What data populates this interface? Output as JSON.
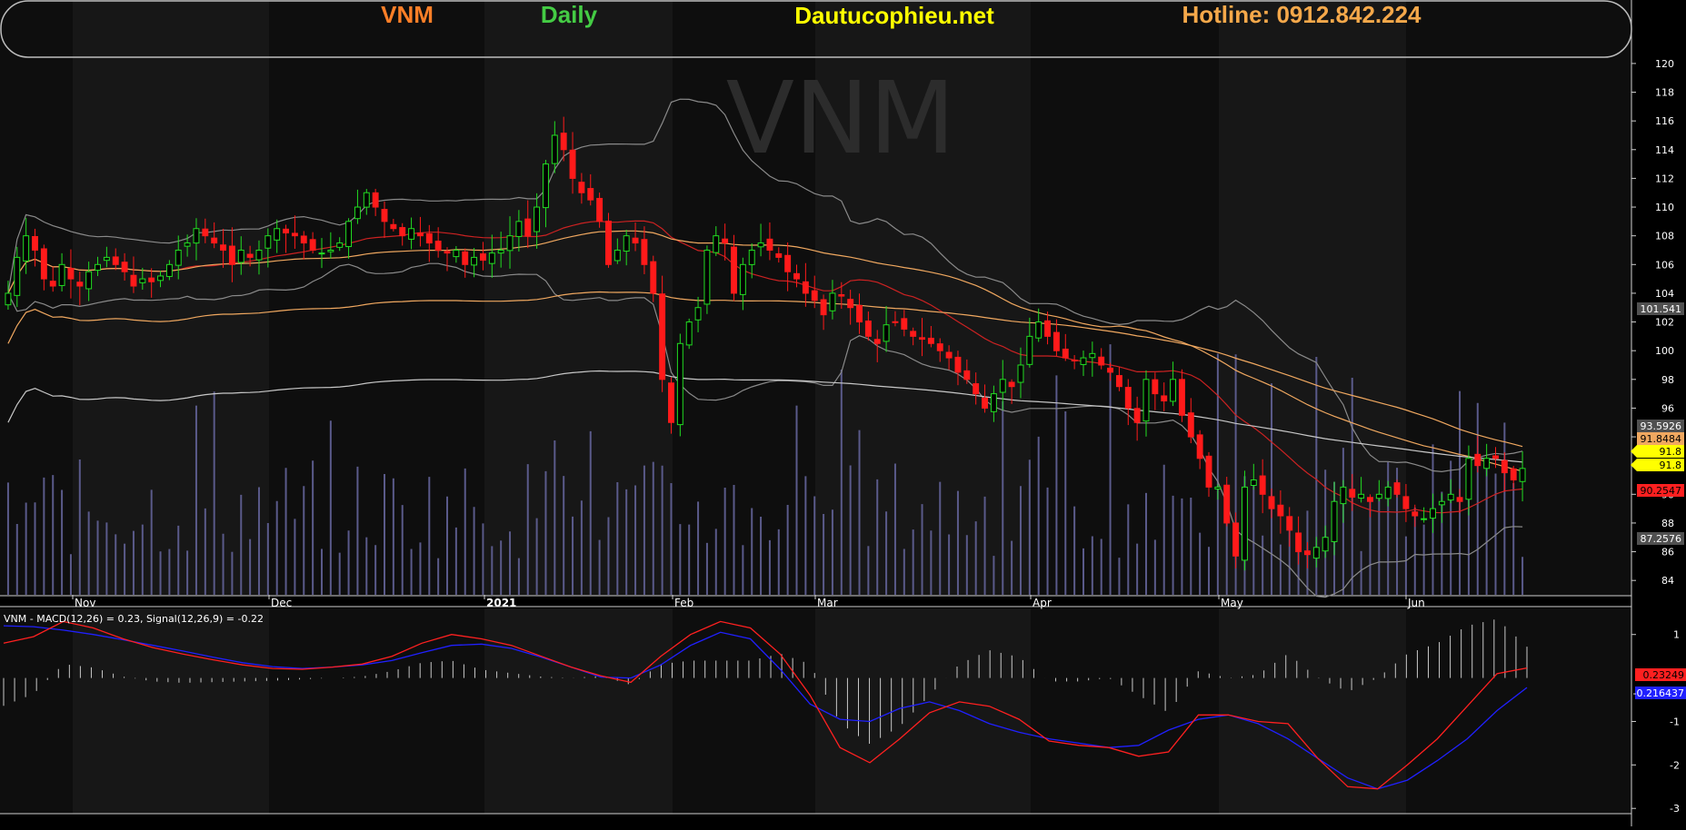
{
  "header": {
    "symbol": "VNM",
    "interval": "Daily",
    "site": "Dautucophieu.net",
    "hotline": "Hotline: 0912.842.224",
    "watermark": "VNM"
  },
  "colors": {
    "background": "#000000",
    "up_candle": "#22dd22",
    "down_candle": "#ff1a1a",
    "volume": "#5a5a8a",
    "ma20": "#cc2222",
    "ma50": "#f0a860",
    "ma100": "#f0a860",
    "ma200": "#c8c8c8",
    "bollinger": "#8a8a8a",
    "macd": "#ff2020",
    "signal": "#2020ff",
    "histogram": "#c8c8c8",
    "symbol_text": "#ff7f27",
    "interval_text": "#44cc44",
    "site_text": "#ffff00",
    "hotline_text": "#f5a84a"
  },
  "chart_data": [
    {
      "type": "candlestick",
      "y_ticks": [
        84,
        86,
        88,
        90,
        92,
        94,
        96,
        98,
        100,
        102,
        104,
        106,
        108,
        110,
        112,
        114,
        116,
        118,
        120
      ],
      "ylim": [
        83,
        120.5
      ],
      "month_labels": [
        "Nov",
        "Dec",
        "2021",
        "Feb",
        "Mar",
        "Apr",
        "May",
        "Jun"
      ],
      "price_labels": [
        "101.541",
        "93.5926",
        "91.8484",
        "91.8",
        "91.8",
        "90.2547",
        "87.2576"
      ],
      "closes": [
        104,
        106.5,
        108,
        107,
        105,
        104.5,
        106,
        105,
        104.5,
        105.5,
        106,
        106.5,
        106,
        105.5,
        104.5,
        105,
        104.8,
        105.2,
        106,
        107,
        107.5,
        108.5,
        108,
        107.5,
        107,
        106,
        107,
        106.5,
        107,
        108,
        108.5,
        108.2,
        108,
        107.5,
        107,
        106.8,
        107,
        107.5,
        109,
        110,
        111,
        110,
        109,
        108.5,
        108,
        108.5,
        108,
        107.5,
        107,
        106.8,
        107,
        106,
        106.5,
        106.3,
        106.8,
        107,
        108,
        109,
        108,
        110,
        113,
        115,
        114,
        112,
        111,
        110.5,
        109,
        106,
        107,
        108,
        107.5,
        106,
        104,
        98,
        95,
        100.5,
        102,
        103,
        107,
        108,
        107.5,
        104,
        106,
        107,
        107.5,
        107,
        106.5,
        105.5,
        105,
        104,
        103.5,
        102.5,
        104,
        103.8,
        103,
        102,
        101,
        100.5,
        101.8,
        102,
        101.5,
        101,
        100.8,
        100.5,
        100,
        99.5,
        98.5,
        98,
        97,
        96,
        97,
        98,
        97.5,
        99,
        101,
        102,
        101,
        100,
        99.5,
        99.3,
        99.5,
        99.8,
        99,
        98.5,
        97.5,
        96,
        95,
        98,
        97,
        96.5,
        98,
        95.5,
        94,
        92.5,
        90.5,
        90.5,
        88,
        85.7,
        90.5,
        91,
        90,
        89,
        88.5,
        87.5,
        86,
        85.8,
        86.3,
        87,
        89.5,
        90.5,
        89.8,
        90,
        89.5,
        90,
        90.5,
        90,
        89,
        88.5,
        88.3,
        89,
        89.5,
        90,
        89.5,
        92.5,
        92,
        92.5,
        92.5,
        91.5,
        91,
        91.8
      ]
    },
    {
      "type": "line",
      "title": "VNM - MACD(12,26) = 0.23, Signal(12,26,9) = -0.22",
      "series": [
        {
          "name": "MACD(12,26)",
          "values": [
            0.8,
            0.95,
            1.3,
            1.15,
            0.9,
            0.7,
            0.55,
            0.42,
            0.3,
            0.22,
            0.2,
            0.25,
            0.32,
            0.5,
            0.8,
            1.0,
            0.9,
            0.75,
            0.5,
            0.25,
            0.05,
            -0.1,
            0.5,
            1.0,
            1.3,
            1.15,
            0.55,
            -0.4,
            -1.6,
            -1.95,
            -1.4,
            -0.8,
            -0.55,
            -0.65,
            -0.95,
            -1.45,
            -1.55,
            -1.6,
            -1.8,
            -1.7,
            -0.85,
            -0.85,
            -1.0,
            -1.05,
            -1.85,
            -2.5,
            -2.55,
            -2.0,
            -1.4,
            -0.65,
            0.1,
            0.23
          ]
        },
        {
          "name": "Signal(12,26,9)",
          "values": [
            1.2,
            1.18,
            1.1,
            1.0,
            0.88,
            0.75,
            0.62,
            0.48,
            0.35,
            0.26,
            0.22,
            0.25,
            0.3,
            0.4,
            0.58,
            0.75,
            0.78,
            0.68,
            0.48,
            0.25,
            0.02,
            0.0,
            0.3,
            0.75,
            1.05,
            0.9,
            0.2,
            -0.6,
            -0.95,
            -1.0,
            -0.7,
            -0.55,
            -0.75,
            -1.05,
            -1.25,
            -1.4,
            -1.5,
            -1.6,
            -1.55,
            -1.2,
            -0.95,
            -0.85,
            -1.05,
            -1.4,
            -1.85,
            -2.3,
            -2.55,
            -2.35,
            -1.9,
            -1.4,
            -0.75,
            -0.22
          ]
        }
      ],
      "y_ticks": [
        1,
        -1,
        -2,
        -3
      ],
      "ylim": [
        -3.1,
        1.6
      ],
      "value_labels": [
        "0.23249",
        "-0.216437"
      ]
    }
  ]
}
